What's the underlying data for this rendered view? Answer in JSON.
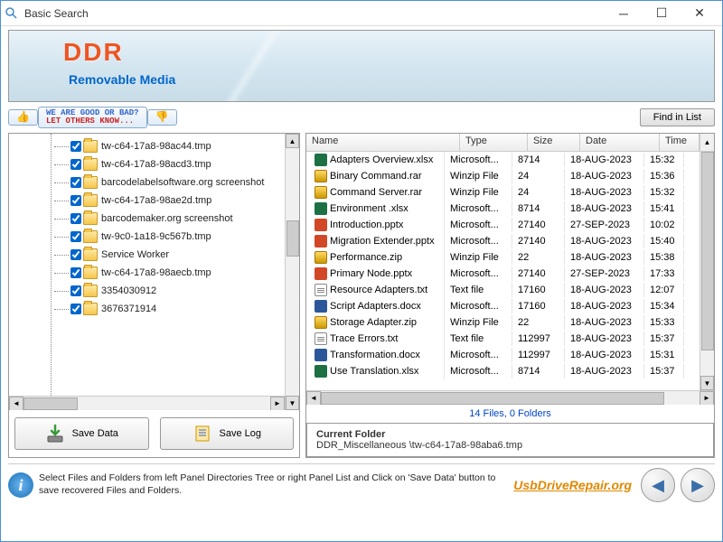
{
  "window": {
    "title": "Basic Search"
  },
  "banner": {
    "brand": "DDR",
    "subtitle": "Removable Media"
  },
  "tagbar": {
    "line1": "WE ARE GOOD OR BAD?",
    "line2": "LET OTHERS KNOW...",
    "find_button": "Find in List"
  },
  "tree": {
    "items": [
      {
        "label": "tw-c64-17a8-98ac44.tmp"
      },
      {
        "label": "tw-c64-17a8-98acd3.tmp"
      },
      {
        "label": "barcodelabelsoftware.org screenshot"
      },
      {
        "label": "tw-c64-17a8-98ae2d.tmp"
      },
      {
        "label": "barcodemaker.org screenshot"
      },
      {
        "label": "tw-9c0-1a18-9c567b.tmp"
      },
      {
        "label": "Service Worker"
      },
      {
        "label": "tw-c64-17a8-98aecb.tmp"
      },
      {
        "label": "3354030912"
      },
      {
        "label": "3676371914"
      }
    ]
  },
  "buttons": {
    "save_data": "Save Data",
    "save_log": "Save Log"
  },
  "list": {
    "headers": {
      "name": "Name",
      "type": "Type",
      "size": "Size",
      "date": "Date",
      "time": "Time"
    },
    "rows": [
      {
        "icon": "xlsx",
        "name": "Adapters Overview.xlsx",
        "type": "Microsoft...",
        "size": "8714",
        "date": "18-AUG-2023",
        "time": "15:32"
      },
      {
        "icon": "rar",
        "name": "Binary Command.rar",
        "type": "Winzip File",
        "size": "24",
        "date": "18-AUG-2023",
        "time": "15:36"
      },
      {
        "icon": "rar",
        "name": "Command Server.rar",
        "type": "Winzip File",
        "size": "24",
        "date": "18-AUG-2023",
        "time": "15:32"
      },
      {
        "icon": "xlsx",
        "name": "Environment .xlsx",
        "type": "Microsoft...",
        "size": "8714",
        "date": "18-AUG-2023",
        "time": "15:41"
      },
      {
        "icon": "pptx",
        "name": "Introduction.pptx",
        "type": "Microsoft...",
        "size": "27140",
        "date": "27-SEP-2023",
        "time": "10:02"
      },
      {
        "icon": "pptx",
        "name": "Migration Extender.pptx",
        "type": "Microsoft...",
        "size": "27140",
        "date": "18-AUG-2023",
        "time": "15:40"
      },
      {
        "icon": "zip",
        "name": "Performance.zip",
        "type": "Winzip File",
        "size": "22",
        "date": "18-AUG-2023",
        "time": "15:38"
      },
      {
        "icon": "pptx",
        "name": "Primary Node.pptx",
        "type": "Microsoft...",
        "size": "27140",
        "date": "27-SEP-2023",
        "time": "17:33"
      },
      {
        "icon": "txt",
        "name": "Resource Adapters.txt",
        "type": "Text file",
        "size": "17160",
        "date": "18-AUG-2023",
        "time": "12:07"
      },
      {
        "icon": "docx",
        "name": "Script Adapters.docx",
        "type": "Microsoft...",
        "size": "17160",
        "date": "18-AUG-2023",
        "time": "15:34"
      },
      {
        "icon": "zip",
        "name": "Storage Adapter.zip",
        "type": "Winzip File",
        "size": "22",
        "date": "18-AUG-2023",
        "time": "15:33"
      },
      {
        "icon": "txt",
        "name": "Trace Errors.txt",
        "type": "Text file",
        "size": "112997",
        "date": "18-AUG-2023",
        "time": "15:37"
      },
      {
        "icon": "docx",
        "name": "Transformation.docx",
        "type": "Microsoft...",
        "size": "112997",
        "date": "18-AUG-2023",
        "time": "15:31"
      },
      {
        "icon": "xlsx",
        "name": "Use Translation.xlsx",
        "type": "Microsoft...",
        "size": "8714",
        "date": "18-AUG-2023",
        "time": "15:37"
      }
    ],
    "status": "14 Files, 0 Folders"
  },
  "current_folder": {
    "title": "Current Folder",
    "path": "DDR_Miscellaneous \\tw-c64-17a8-98aba6.tmp"
  },
  "footer": {
    "hint": "Select Files and Folders from left Panel Directories Tree or right Panel List and Click on 'Save Data' button to save recovered Files and Folders.",
    "brand": "UsbDriveRepair.org"
  }
}
